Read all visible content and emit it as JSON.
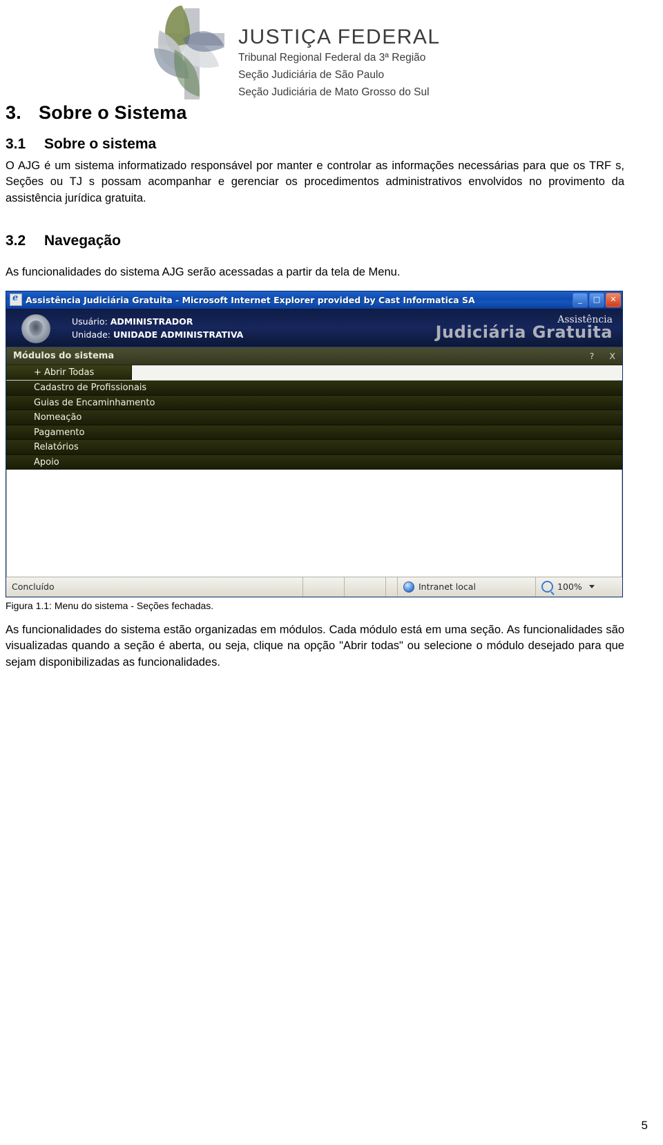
{
  "header": {
    "org_title": "JUSTIÇA FEDERAL",
    "org_line1": "Tribunal Regional Federal da 3ª Região",
    "org_line2": "Seção Judiciária de São Paulo",
    "org_line3": "Seção Judiciária de Mato Grosso do Sul",
    "logo_icon": "justica-federal-cross-logo"
  },
  "document": {
    "section_number": "3.",
    "section_title": "Sobre o Sistema",
    "sub1_number": "3.1",
    "sub1_title": "Sobre o sistema",
    "sub1_paragraph": "O AJG é um sistema informatizado responsável por manter e controlar as informações necessárias para que os TRF s, Seções ou TJ s possam acompanhar e gerenciar os procedimentos administrativos envolvidos no provimento da assistência jurídica gratuita.",
    "sub2_number": "3.2",
    "sub2_title": "Navegação",
    "sub2_paragraph": "As funcionalidades do sistema AJG serão acessadas a partir da tela de Menu.",
    "figure_caption": "Figura 1.1: Menu do sistema - Seções fechadas.",
    "closing_paragraph": "As funcionalidades do sistema estão organizadas em módulos. Cada módulo está em uma seção. As funcionalidades são visualizadas quando a seção é aberta, ou seja, clique na opção \"Abrir todas\" ou selecione o módulo desejado para que sejam disponibilizadas as funcionalidades.",
    "page_number": "5"
  },
  "screenshot": {
    "window_title": "Assistência Judiciária Gratuita - Microsoft Internet Explorer provided by Cast Informatica SA",
    "window_icon": "internet-explorer-icon",
    "window_buttons": {
      "minimize": "_",
      "maximize": "□",
      "close": "✕"
    },
    "banner": {
      "seal_icon": "brasao-republica-icon",
      "user_label": "Usuário:",
      "user_value": "ADMINISTRADOR",
      "unit_label": "Unidade:",
      "unit_value": "UNIDADE ADMINISTRATIVA",
      "brand_line1": "Assistência",
      "brand_line2": "Judiciária Gratuita"
    },
    "module_bar": {
      "label": "Módulos do sistema",
      "help_icon": "?",
      "close_icon": "X"
    },
    "menu_items": [
      "+ Abrir Todas",
      "Cadastro de Profissionais",
      "Guias de Encaminhamento",
      "Nomeação",
      "Pagamento",
      "Relatórios",
      "Apoio"
    ],
    "status_bar": {
      "status_text": "Concluído",
      "zone_icon": "globe-icon",
      "zone_text": "Intranet local",
      "zoom_icon": "zoom-icon",
      "zoom_text": "100%",
      "zoom_caret": "chevron-down-icon"
    }
  }
}
